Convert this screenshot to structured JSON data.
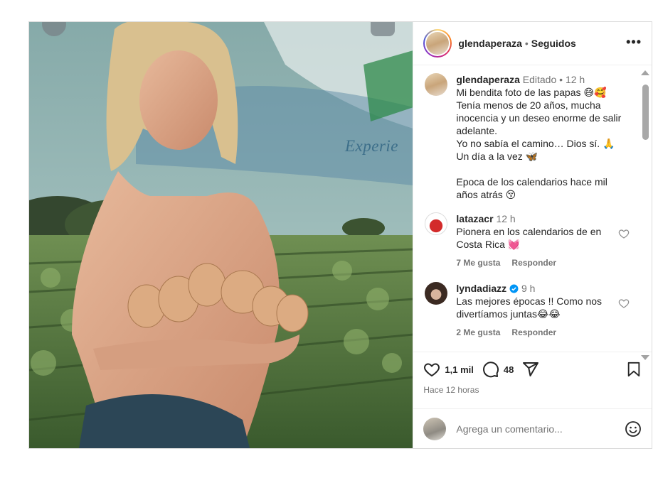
{
  "post": {
    "author": "glendaperaza",
    "follow_state": "Seguidos",
    "more_label": "•••",
    "photo_overlay_text": "Experie"
  },
  "caption": {
    "username": "glendaperaza",
    "edited": "Editado",
    "time": "12 h",
    "lines": [
      "Mi bendita foto de las papas 😅🥰",
      "Tenía menos de 20 años, mucha inocencia y un deseo enorme de salir adelante.",
      "Yo no sabía el camino… Dios sí. 🙏",
      "Un día a la vez 🦋",
      "",
      "Epoca de los calendarios hace mil años atrás 😚"
    ]
  },
  "comments": [
    {
      "username": "latazacr",
      "time": "12 h",
      "text": "Pionera en los calendarios de en Costa Rica 💓",
      "likes": "7 Me gusta",
      "reply": "Responder",
      "verified": false
    },
    {
      "username": "lyndadiazz",
      "time": "9 h",
      "text": "Las mejores épocas !! Como nos divertíamos juntas😂😂",
      "likes": "2 Me gusta",
      "reply": "Responder",
      "verified": true
    }
  ],
  "stats": {
    "likes": "1,1 mil",
    "comments": "48",
    "posted": "Hace 12 horas"
  },
  "composer": {
    "placeholder": "Agrega un comentario..."
  },
  "icons": {
    "like": "heart-icon",
    "comment": "comment-icon",
    "share": "share-icon",
    "save": "bookmark-icon",
    "emoji": "emoji-icon",
    "verified": "verified-badge-icon"
  },
  "colors": {
    "verified": "#0095f6",
    "muted": "#737373",
    "text": "#262626"
  }
}
